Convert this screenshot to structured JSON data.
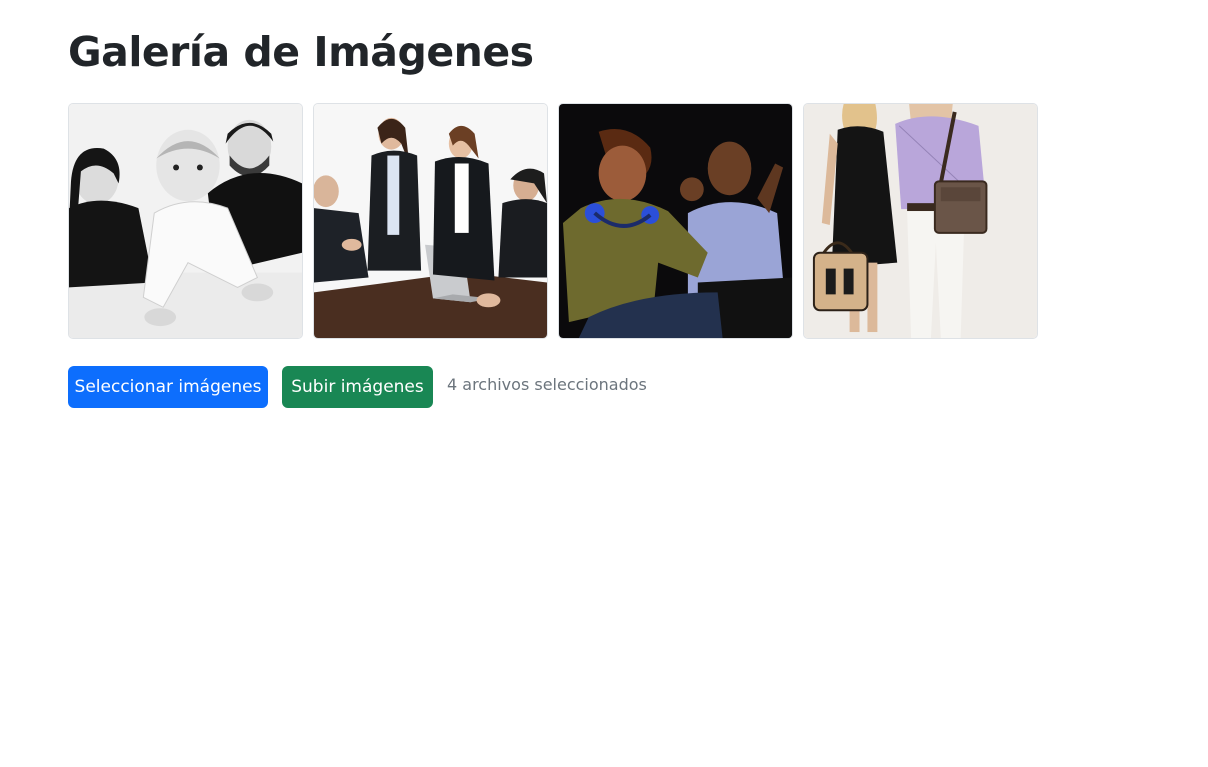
{
  "page": {
    "title": "Galería de Imágenes"
  },
  "gallery": {
    "images": [
      {
        "description": "family-bw-photo"
      },
      {
        "description": "business-meeting-photo"
      },
      {
        "description": "dancing-couple-photo"
      },
      {
        "description": "fashion-couple-photo"
      }
    ]
  },
  "actions": {
    "select_label": "Seleccionar imágenes",
    "upload_label": "Subir imágenes",
    "status_text": "4 archivos seleccionados"
  },
  "colors": {
    "primary": "#0d6efd",
    "success": "#198754",
    "muted": "#6c757d",
    "heading": "#212529"
  }
}
